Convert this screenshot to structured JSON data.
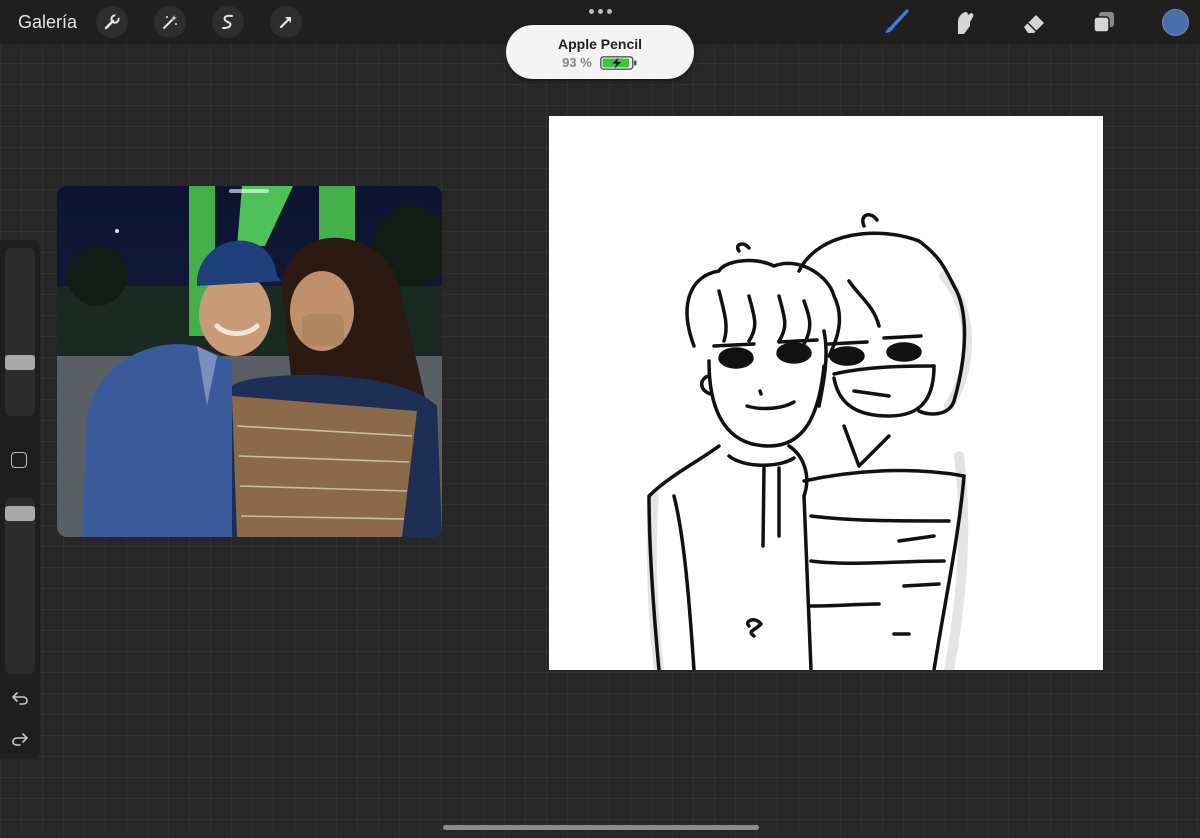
{
  "topbar": {
    "gallery_label": "Galería",
    "left_tools": [
      "wrench-icon",
      "magic-wand-icon",
      "selection-s-icon",
      "arrow-transform-icon"
    ],
    "right_tools": [
      "brush-icon",
      "smudge-icon",
      "eraser-icon",
      "layers-icon"
    ],
    "active_tool": "brush-icon",
    "current_color": "#4a6ea8"
  },
  "pencil_popup": {
    "name": "Apple Pencil",
    "battery_text": "93 %",
    "battery_level": 0.93,
    "battery_color": "#3ac73a"
  },
  "sidebar": {
    "brush_size_level": 0.3,
    "opacity_level": 0.95,
    "controls": [
      "modify-button",
      "undo-icon",
      "redo-icon"
    ]
  },
  "reference": {
    "description_icon": "reference-photo"
  },
  "canvas": {
    "background": "#ffffff"
  }
}
